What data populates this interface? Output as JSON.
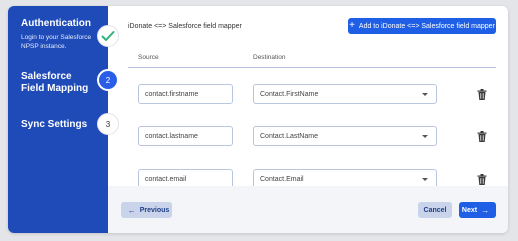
{
  "sidebar": {
    "steps": [
      {
        "title": "Authentication",
        "description": "Login to your Salesforce NPSP instance.",
        "marker": "check-icon",
        "state": "done"
      },
      {
        "title": "Salesforce Field Mapping",
        "description": "",
        "marker": "2",
        "state": "active"
      },
      {
        "title": "Sync Settings",
        "description": "",
        "marker": "3",
        "state": "pending"
      }
    ]
  },
  "header": {
    "title": "iDonate <=> Salesforce field mapper",
    "add_button_label": "Add to iDonate <=> Salesforce field mapper",
    "add_button_icon": "plus-icon"
  },
  "table": {
    "columns": [
      "Source",
      "Destination"
    ],
    "rows": [
      {
        "source": "contact.firstname",
        "destination": "Contact.FirstName"
      },
      {
        "source": "contact.lastname",
        "destination": "Contact.LastName"
      },
      {
        "source": "contact.email",
        "destination": "Contact.Email"
      }
    ]
  },
  "footer": {
    "previous_label": "Previous",
    "cancel_label": "Cancel",
    "next_label": "Next"
  },
  "colors": {
    "sidebar_bg": "#1f4bb8",
    "primary": "#1f5fe6",
    "secondary_button": "#c9d4ea",
    "page_bg": "#e4e5e9"
  }
}
